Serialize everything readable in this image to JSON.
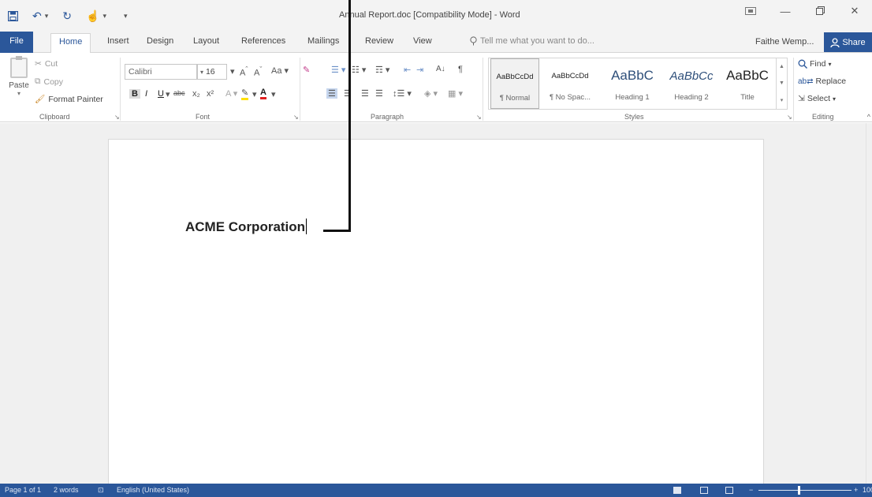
{
  "window": {
    "title": "Annual Report.doc [Compatibility Mode] - Word",
    "minimize": "—",
    "close": "✕"
  },
  "qat": {
    "undo": "↶",
    "redo": "↻",
    "touch": "☝"
  },
  "tabs": {
    "file": "File",
    "items": [
      "Home",
      "Insert",
      "Design",
      "Layout",
      "References",
      "Mailings",
      "Review",
      "View"
    ],
    "tell_me": "Tell me what you want to do...",
    "user": "Faithe Wemp...",
    "share": "Share"
  },
  "clipboard": {
    "paste": "Paste",
    "cut": "Cut",
    "copy": "Copy",
    "format_painter": "Format Painter",
    "label": "Clipboard"
  },
  "font": {
    "name": "Calibri",
    "size": "16",
    "grow": "A",
    "shrink": "A",
    "case": "Aa",
    "bold": "B",
    "italic": "I",
    "underline": "U",
    "strike": "abc",
    "sub": "x₂",
    "sup": "x²",
    "label": "Font"
  },
  "paragraph": {
    "sort": "A↓",
    "marks": "¶",
    "label": "Paragraph"
  },
  "styles": {
    "items": [
      {
        "preview": "AaBbCcDd",
        "name": "¶ Normal"
      },
      {
        "preview": "AaBbCcDd",
        "name": "¶ No Spac..."
      },
      {
        "preview": "AaBbC",
        "name": "Heading 1"
      },
      {
        "preview": "AaBbCc",
        "name": "Heading 2"
      },
      {
        "preview": "AaBbC",
        "name": "Title"
      }
    ],
    "label": "Styles"
  },
  "editing": {
    "find": "Find",
    "replace": "Replace",
    "select": "Select",
    "label": "Editing"
  },
  "document": {
    "text": "ACME Corporation"
  },
  "status": {
    "page": "Page 1 of 1",
    "words": "2 words",
    "language": "English (United States)",
    "zoom_minus": "−",
    "zoom_plus": "+",
    "zoom": "100%"
  },
  "colors": {
    "accent": "#2b579a",
    "ribbon_bg": "#f3f3f3"
  }
}
